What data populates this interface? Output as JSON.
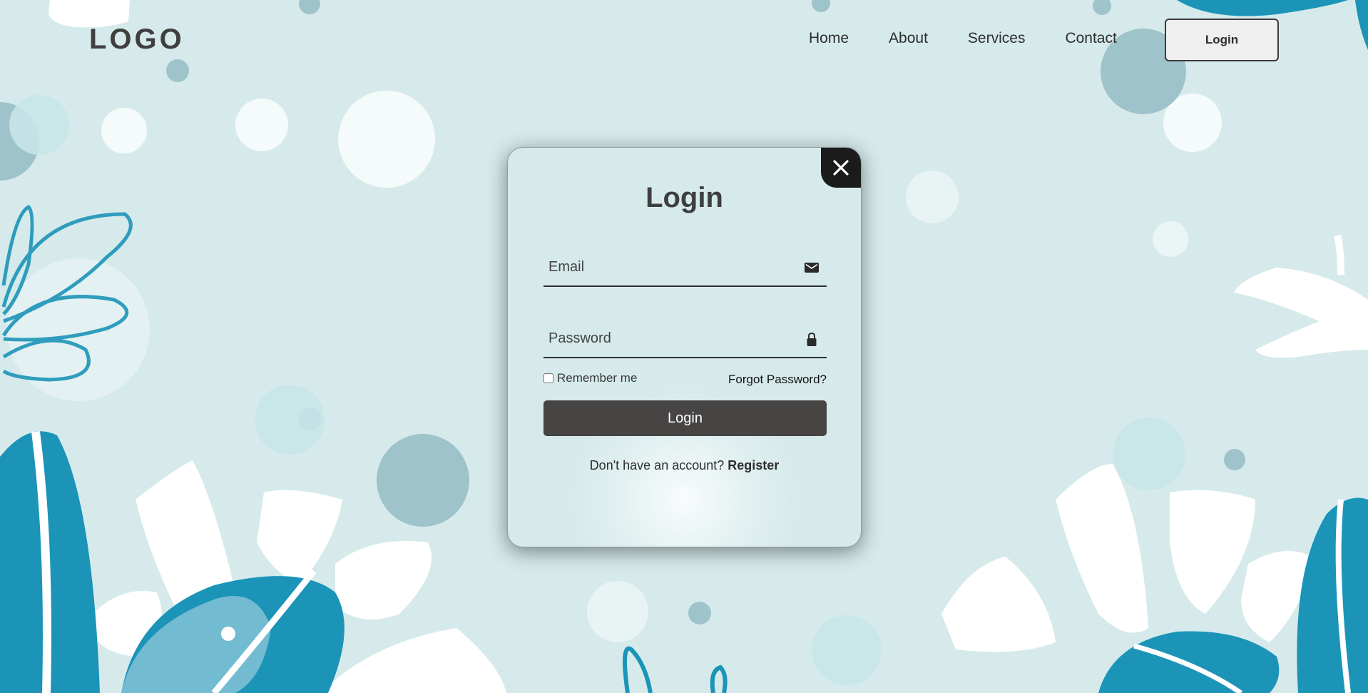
{
  "header": {
    "logo": "LOGO",
    "nav": [
      "Home",
      "About",
      "Services",
      "Contact"
    ],
    "login_button": "Login"
  },
  "modal": {
    "title": "Login",
    "email_placeholder": "Email",
    "password_placeholder": "Password",
    "remember_label": "Remember me",
    "forgot_label": "Forgot Password?",
    "submit_label": "Login",
    "register_prompt": "Don't have an account?",
    "register_label": "Register"
  },
  "colors": {
    "background": "#d6eaeb",
    "accent_blue": "#1b94b8",
    "button_dark": "#474444",
    "close_bg": "#1b1b1b"
  },
  "icons": {
    "close": "close-icon",
    "email": "envelope-icon",
    "password": "lock-icon"
  }
}
